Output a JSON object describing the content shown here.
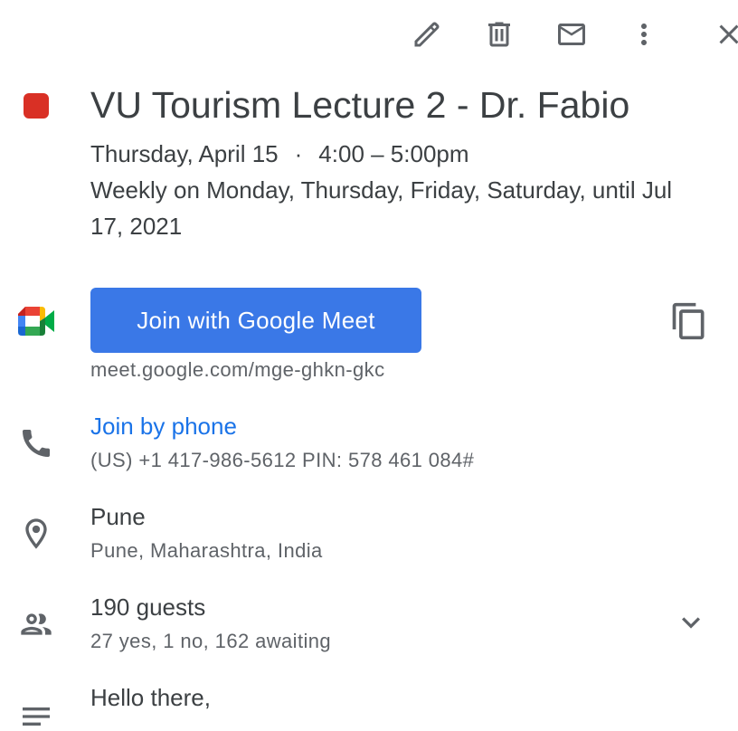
{
  "toolbar": {
    "edit_icon": "pencil-icon",
    "delete_icon": "trash-icon",
    "email_icon": "mail-icon",
    "more_icon": "more-vert-icon",
    "close_icon": "close-icon"
  },
  "event": {
    "color": "#d93025",
    "title": "VU Tourism Lecture 2 - Dr. Fabio",
    "date": "Thursday, April 15",
    "separator": "·",
    "time": "4:00 – 5:00pm",
    "recurrence": "Weekly on Monday, Thursday, Friday, Saturday, until Jul 17, 2021"
  },
  "meet": {
    "button_label": "Join with Google Meet",
    "button_color": "#3a78e7",
    "url": "meet.google.com/mge-ghkn-gkc"
  },
  "phone": {
    "link_label": "Join by phone",
    "link_color": "#1a73e8",
    "detail": "(US) +1 417-986-5612 PIN: 578 461 084#"
  },
  "location": {
    "name": "Pune",
    "detail": "Pune, Maharashtra, India"
  },
  "guests": {
    "count_label": "190 guests",
    "summary": "27 yes, 1 no, 162 awaiting"
  },
  "description": {
    "text": "Hello there,"
  }
}
